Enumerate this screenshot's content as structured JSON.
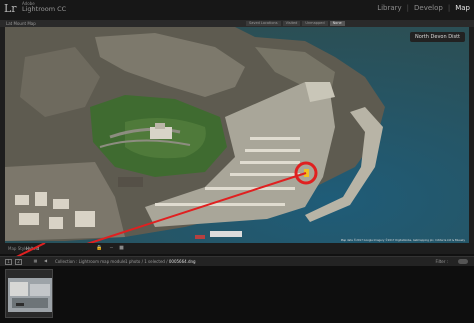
{
  "app": {
    "logo": "Lr",
    "brand_small": "Adobe",
    "brand": "Lightroom CC"
  },
  "modules": [
    "Library",
    "Develop",
    "Map"
  ],
  "location_text": "Lat Mount Map",
  "map_tabs": [
    "Saved Locations",
    "Visited",
    "Unmapped",
    "None"
  ],
  "map": {
    "location_label": "North Devon Distt",
    "attribution": "Map data ©2017 Google Imagery ©2017 DigitalGlobe, Getmapping plc, Infoterra Ltd & Bluesky"
  },
  "map_toolbar": {
    "style_label": "Map Style :",
    "style_value": "Hybrid"
  },
  "filmstrip_bar": {
    "source": "Collection : Lightroom map module",
    "count": "1 photo / 1 selected /",
    "file": "0005664.dng",
    "filter_label": "Filter :"
  },
  "colors": {
    "accent_red": "#e02020",
    "active_module": "#e6e6e6"
  },
  "icons": [
    "lock-icon",
    "zoom-out-icon",
    "zoom-slider-icon",
    "grid-view-icon",
    "loupe-view-icon",
    "nav-back-icon",
    "nav-forward-icon"
  ]
}
